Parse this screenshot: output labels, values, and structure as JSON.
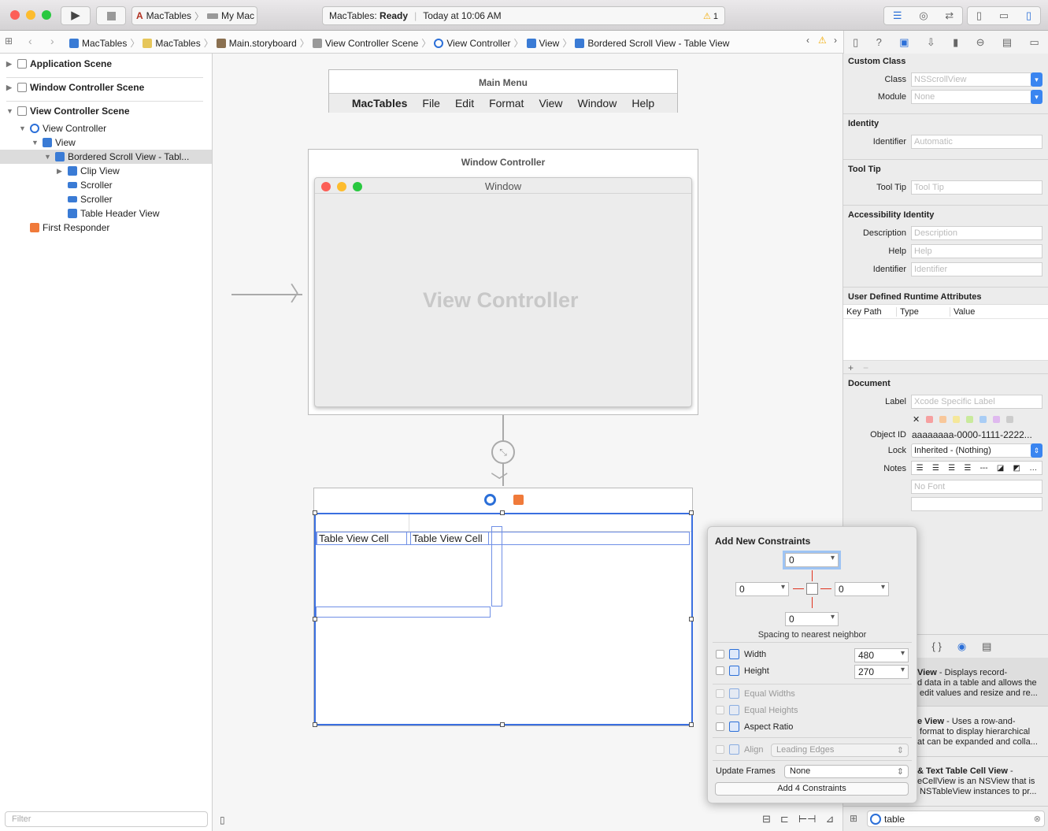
{
  "toolbar": {
    "scheme": "MacTables",
    "destination": "My Mac",
    "status_app": "MacTables:",
    "status_state": "Ready",
    "status_time": "Today at 10:06 AM",
    "warning_count": "1"
  },
  "jumpbar": [
    "MacTables",
    "MacTables",
    "Main.storyboard",
    "View Controller Scene",
    "View Controller",
    "View",
    "Bordered Scroll View - Table View"
  ],
  "navigator": {
    "items": [
      {
        "label": "Application Scene"
      },
      {
        "label": "Window Controller Scene"
      },
      {
        "label": "View Controller Scene"
      },
      {
        "label": "View Controller"
      },
      {
        "label": "View"
      },
      {
        "label": "Bordered Scroll View - Tabl..."
      },
      {
        "label": "Clip View"
      },
      {
        "label": "Scroller"
      },
      {
        "label": "Scroller"
      },
      {
        "label": "Table Header View"
      },
      {
        "label": "First Responder"
      }
    ],
    "filter_placeholder": "Filter"
  },
  "canvas": {
    "menu_title": "Main Menu",
    "menu_items": [
      "MacTables",
      "File",
      "Edit",
      "Format",
      "View",
      "Window",
      "Help"
    ],
    "window_controller_title": "Window Controller",
    "window_title": "Window",
    "view_controller_label": "View Controller",
    "cells": [
      "Table View Cell",
      "Table View Cell"
    ]
  },
  "constraints": {
    "title": "Add New Constraints",
    "top": "0",
    "left": "0",
    "right": "0",
    "bottom": "0",
    "spacing_label": "Spacing to nearest neighbor",
    "width_label": "Width",
    "width_value": "480",
    "height_label": "Height",
    "height_value": "270",
    "equal_widths": "Equal Widths",
    "equal_heights": "Equal Heights",
    "aspect_ratio": "Aspect Ratio",
    "align_label": "Align",
    "align_value": "Leading Edges",
    "update_frames_label": "Update Frames",
    "update_frames_value": "None",
    "add_button": "Add 4 Constraints"
  },
  "inspector": {
    "custom_class": "Custom Class",
    "class_label": "Class",
    "class_placeholder": "NSScrollView",
    "module_label": "Module",
    "module_placeholder": "None",
    "identity": "Identity",
    "identifier_label": "Identifier",
    "identifier_placeholder": "Automatic",
    "tooltip": "Tool Tip",
    "tooltip_label": "Tool Tip",
    "tooltip_placeholder": "Tool Tip",
    "accessibility": "Accessibility Identity",
    "desc_label": "Description",
    "desc_placeholder": "Description",
    "help_label": "Help",
    "help_placeholder": "Help",
    "acc_id_label": "Identifier",
    "acc_id_placeholder": "Identifier",
    "udra": "User Defined Runtime Attributes",
    "col_keypath": "Key Path",
    "col_type": "Type",
    "col_value": "Value",
    "document": "Document",
    "doc_label": "Label",
    "doc_label_placeholder": "Xcode Specific Label",
    "object_id_label": "Object ID",
    "object_id": "aaaaaaaa-0000-1111-2222...",
    "lock_label": "Lock",
    "lock_value": "Inherited - (Nothing)",
    "notes_label": "Notes",
    "font_placeholder": "No Font"
  },
  "library": {
    "items": [
      {
        "title": "View",
        "desc": " - Displays record-\nd data in a table and allows the\n edit values and resize and re..."
      },
      {
        "title": "e View",
        "desc": " - Uses a row-and-\n format to display hierarchical\nat can be expanded and colla..."
      },
      {
        "title": "& Text Table Cell View",
        "desc": " -\neCellView is an NSView that is\n NSTableView instances to pr..."
      }
    ],
    "search_value": "table"
  },
  "colors": {
    "accent": "#2b6fd8",
    "constraint_red": "#e0321e",
    "selection": "#dcdcdc"
  }
}
